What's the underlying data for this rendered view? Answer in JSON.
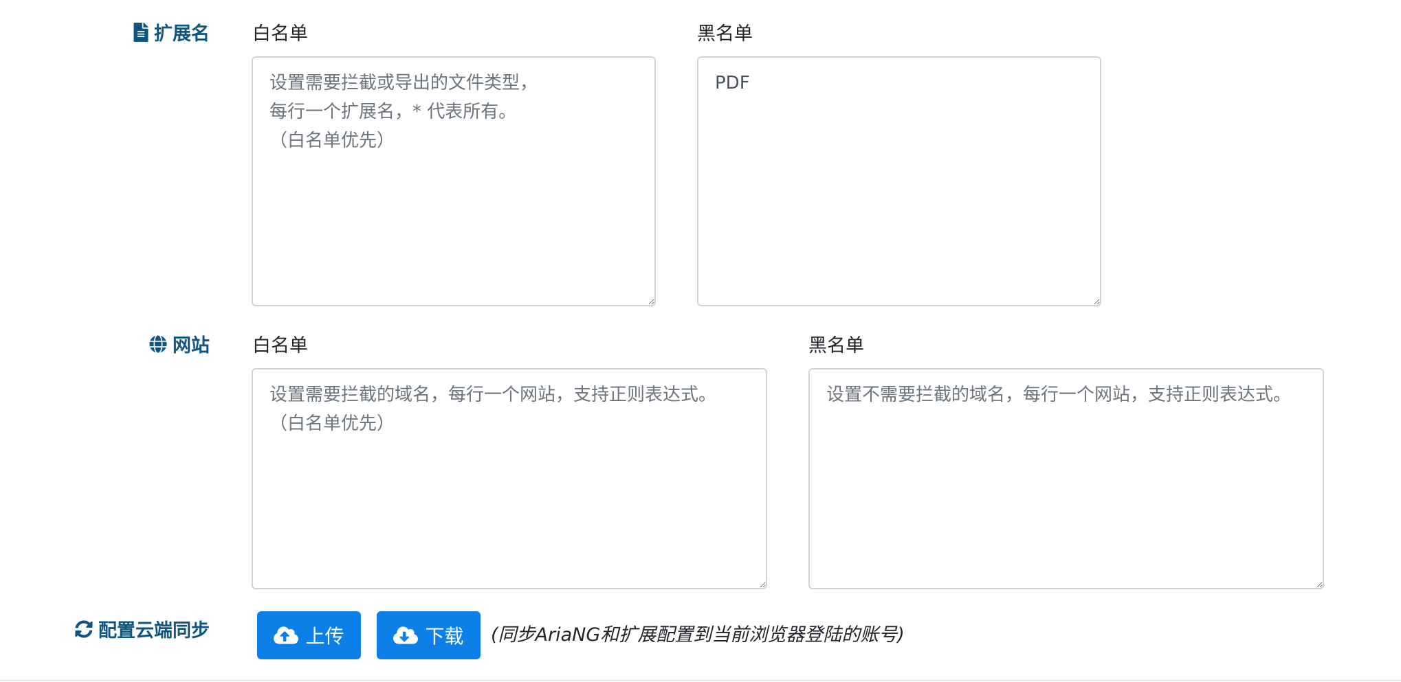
{
  "extensions": {
    "section_label": "扩展名",
    "section_icon": "file-icon",
    "whitelist": {
      "label": "白名单",
      "value": "",
      "placeholder": "设置需要拦截或导出的文件类型，\n每行一个扩展名，* 代表所有。\n（白名单优先）"
    },
    "blacklist": {
      "label": "黑名单",
      "value": "PDF",
      "placeholder": ""
    }
  },
  "websites": {
    "section_label": "网站",
    "section_icon": "globe-icon",
    "whitelist": {
      "label": "白名单",
      "value": "",
      "placeholder": "设置需要拦截的域名，每行一个网站，支持正则表达式。\n（白名单优先）"
    },
    "blacklist": {
      "label": "黑名单",
      "value": "",
      "placeholder": "设置不需要拦截的域名，每行一个网站，支持正则表达式。"
    }
  },
  "cloud_sync": {
    "section_label": "配置云端同步",
    "section_icon": "sync-icon",
    "upload_label": "上传",
    "upload_icon": "cloud-upload-icon",
    "download_label": "下载",
    "download_icon": "cloud-download-icon",
    "note": "(同步AriaNG和扩展配置到当前浏览器登陆的账号)"
  },
  "colors": {
    "section_label": "#10557f",
    "button_primary": "#0d7fe8",
    "input_border": "#ced4da"
  }
}
